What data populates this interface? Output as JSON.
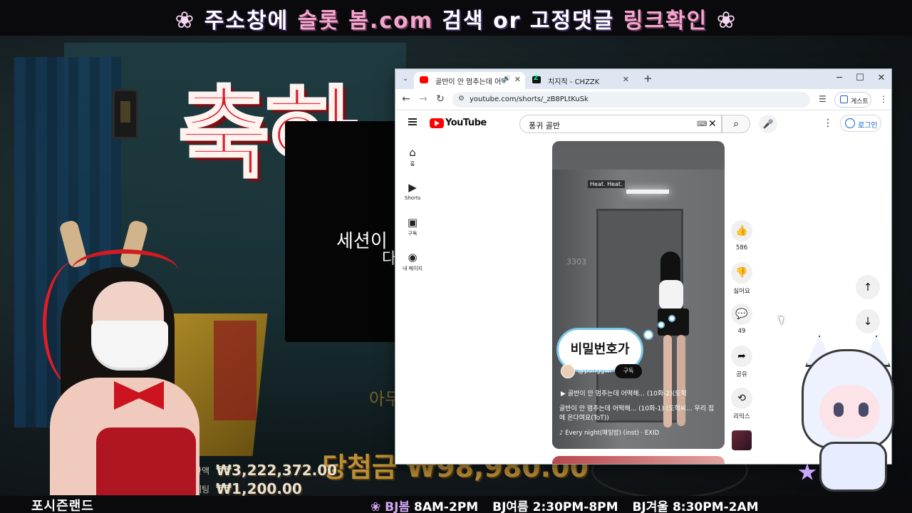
{
  "stream": {
    "top_banner": {
      "part1": "주소창에",
      "part2": "슬롯 봄.com",
      "part3": "검색",
      "part4": "or",
      "part5": "고정댓글",
      "part6": "링크확인",
      "flower": "❀"
    },
    "background_text": {
      "big_title": "축하",
      "session_line1": "세션이",
      "session_line2": "다",
      "ghost": "아무",
      "jackpot": "당첨금 ₩98,980.00",
      "balance_label": "잔액",
      "balance_value": "₩3,222,372.00",
      "bet_label": "베팅",
      "bet_value": "₩1,200.00"
    },
    "ticker": {
      "left": "포시즌랜드",
      "flower": "❀",
      "bj1": "BJ봄",
      "time1": "8AM-2PM",
      "bj2": "BJ여름",
      "time2": "2:30PM-8PM",
      "bj3": "BJ겨울",
      "time3": "8:30PM-2AM"
    }
  },
  "browser": {
    "tabs": [
      {
        "title": "골반이 안 멈추는데 어떡해",
        "active": true
      },
      {
        "title": "치지직 - CHZZK",
        "active": false
      }
    ],
    "new_tab": "+",
    "window_controls": [
      "─",
      "☐",
      "✕"
    ],
    "url": "youtube.com/shorts/_zB8PLtKuSk",
    "guest_label": "게스트"
  },
  "youtube": {
    "logo_text": "YouTube",
    "search_value": "퐁귀 골반",
    "login_label": "로그인",
    "sidebar": [
      {
        "icon": "⌂",
        "label": "홈"
      },
      {
        "icon": "▶",
        "label": "Shorts"
      },
      {
        "icon": "▣",
        "label": "구독"
      },
      {
        "icon": "◉",
        "label": "내 페이지"
      }
    ],
    "short": {
      "caption": "Heat. Heat.",
      "door_number": "3303",
      "bubble_text": "비밀번호가",
      "channel": "@ponggwi",
      "subscribe_label": "구독",
      "playlist_line": "▶ 골반이 안 멈추는데 어떡해... (10화-2)(도혁",
      "description": "골반이 안 멈추는데 어떡해... (10화-1) (도혁씨... 우리 집에 온다며요(ToT))",
      "music": "♪ Every night(매일밤) (inst) · EXID"
    },
    "actions": [
      {
        "icon": "👍",
        "label": "586"
      },
      {
        "icon": "👎",
        "label": "싫어요"
      },
      {
        "icon": "💬",
        "label": "49"
      },
      {
        "icon": "➦",
        "label": "공유"
      },
      {
        "icon": "⟲",
        "label": "리믹스"
      }
    ],
    "nav_up": "↑",
    "nav_down": "↓"
  }
}
